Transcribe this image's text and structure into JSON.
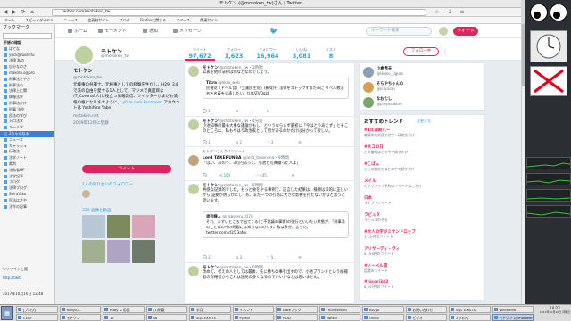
{
  "window": {
    "title": "モトケン (@motoken_tw)さん | Twitter"
  },
  "browser": {
    "url": "twitter.com/motoken_tw",
    "bookmarks": [
      "ホーム",
      "スピードダイヤル",
      "ニュース",
      "会員制サイト",
      "ブログ",
      "Firefoxに関する",
      "スペース",
      "関連サイト"
    ]
  },
  "sidebar": {
    "header": "ブックマーク",
    "folder_label": "手帳の確認",
    "items": [
      "はてな",
      "yuck@fukenfu",
      "法律 私の",
      "自分なのさ",
      "makoto.s@pro",
      "刑事法さやか",
      "刑事法の...",
      "法律上に関",
      "情報法学",
      "刑事法かけ",
      "刑事 法令",
      "民法の学び",
      "入口法学",
      "ルール学",
      "2ちゃんねる",
      "ニュース",
      "キャッシュ",
      "行政法",
      "法学ノート",
      "裁判",
      "法務省HP",
      "法学記事",
      "ブログ",
      "法律ブログ",
      "ShiraYako",
      "民法はさや",
      "法令の記事"
    ],
    "selected_index": 14,
    "footer_text": "ウクライナと聞",
    "footer_link": "http://twitt",
    "date": "2017年10月16日 12:48"
  },
  "twitter": {
    "nav": [
      "ホーム",
      "モーメント",
      "通知",
      "メッセージ"
    ],
    "search_placeholder": "キーワード検索",
    "tweet_button": "ツイート",
    "profile": {
      "name": "モトケン",
      "handle": "@motoken_tw",
      "stats": [
        {
          "label": "ツイート",
          "value": "97,672"
        },
        {
          "label": "フォロー",
          "value": "1,623"
        },
        {
          "label": "フォロワー",
          "value": "16,964"
        },
        {
          "label": "いいね",
          "value": "3,081"
        },
        {
          "label": "リスト",
          "value": "8"
        }
      ],
      "follow_button": "フォロー中",
      "bio_name": "モトケン",
      "bio_handle": "@motoken_tw",
      "bio_text": "元検事の弁護士。元検事としての経験を生かし、H29. 3まで法の自由を愛する1人として、マジメで真面目な(T_Corona?人)に役立つ情報発信、ツイッターがまだも情報の根になりますように。",
      "bio_link_text": "yfaio.com Facebook",
      "bio_more": "アカウントは Yoshihiro Yabe",
      "bio_site": "motoken.net",
      "bio_joined": "2009年12月に登録",
      "bio_tweet_btn": "ツイート",
      "followers_you_know": "1人の知り合いのフォロワー",
      "media_label": "329 画像と動画"
    }
  },
  "tweets": [
    {
      "name": "モトケン",
      "handle": "@motoken_tw",
      "time": "・3時間",
      "body": "公表を他の法律は何などなのでしょう。",
      "quote_author": "Tikra",
      "quote_handle": "@tikra_web",
      "quote_text": "民進党（ドベル音）「立憲民主党」(新党)行 法律をストップするために リベル教法名を名義を公表したい。tl.tt/ZVQqzL",
      "actions": [
        "1",
        "",
        "",
        ""
      ]
    },
    {
      "name": "モトケン",
      "handle": "@motoken_tw",
      "time": "・4分前",
      "body": "小池知事の最も大事な議論がもし、というならまず最初に「今はとりあえず」とそこのところに、私もやはり政治家として何があるのかだけは分かって欲しい。",
      "actions": [
        "1",
        "2",
        "3",
        ""
      ]
    },
    {
      "retweeted": "モトケンさんがリツイート",
      "name": "Lord TAKERUNBA",
      "handle": "@lord_takeruna",
      "time": "・9時間",
      "body": "「はい、あのう、3万円払って、小池と写真撮った人よ」",
      "actions": [
        "",
        "164",
        "445",
        ""
      ]
    },
    {
      "name": "モトケン",
      "handle": "@motoken_tw",
      "time": "・6時間",
      "body": "共感な記録的でした。もっと食をやる事例で、証言した結果は、検察は法的に正しいから 証拠が明らかにしても、まだ一つの行為に大きな影響を持たないかなと思うと思います。",
      "quote_author": "渡辺輝人",
      "quote_handle": "@nabeteru1Q78",
      "quote_text": "それ、まずいところで出てくる(と不思議の事情)の強行といいたい状態が、「刑事法のことばの中の問題には知らないのです。私は多分、言った。　twitter.com/d1f23aNv.",
      "actions": [
        "2",
        "3",
        "5",
        ""
      ]
    },
    {
      "name": "モトケン",
      "handle": "@motoken_tw",
      "time": "・6時間",
      "body": "改めて、考えの人としては最後、先に勝ちの事を出すので、小池プランドという候補者の有権者からこれは国民の多くなるのでいいかなとは思いません。",
      "actions": [
        "",
        "",
        "",
        ""
      ]
    }
  ],
  "right": {
    "suggestions": [
      {
        "name": "小倉秀夫",
        "handle": "@Hideo_Ogura"
      },
      {
        "name": "そらやちゃんの",
        "handle": "@kriyasan"
      },
      {
        "name": "なおむし",
        "handle": "@proyasabine"
      }
    ],
    "trends_title": "おすすめトレンド",
    "trends_change": "変更する",
    "trends": [
      {
        "tag": "#1年満期バー",
        "sub": "感情的な知見の文字・研究方法は..."
      },
      {
        "tag": "#ネコの日",
        "sub": "この番組はこの中で試すだけ"
      },
      {
        "tag": "#こばん",
        "sub": "こらの話あてはこの中で試すだけ"
      },
      {
        "tag": "メイル",
        "sub": "ピックアップ予約のツイートはこちら"
      },
      {
        "tag": "日本",
        "sub": "ライブ・ツイート"
      },
      {
        "tag": "ラビュタ",
        "sub": "ラビュタの予告"
      },
      {
        "tag": "#大人の学びミサンドロップ",
        "sub": "3,1万件のツイート"
      },
      {
        "tag": "アリサーディ・ヴィ",
        "sub": "6,156件のツイート"
      },
      {
        "tag": "#ノーベル賞",
        "sub": "話題のツイート"
      },
      {
        "tag": "#nicori342",
        "sub": "6,245件のツイート"
      }
    ]
  },
  "taskbar": {
    "tasks": [
      "[ブログ]",
      "Rubyの...",
      "Ruby & 用語",
      "(1)例題",
      "半月",
      "イベント",
      "Noteブック",
      "Thunderbird",
      "Bのyo",
      "お問い合わせ",
      "SQL EXISTS",
      "Wikipedia",
      "CLAF",
      "モトケン",
      "1k",
      "oo",
      "SQL EXISTS",
      "PyMol",
      "HDD",
      "Twitter",
      "Unico",
      "ビデオ",
      "2ちゃん",
      "モトケン (@motoken_tw)"
    ],
    "active_index": 23,
    "clock_time": "10:22",
    "clock_date": "2017年10月16日 月曜日"
  },
  "colors": {
    "twitter_blue": "#1da1f2",
    "tweet_button": "#e0245e",
    "page_bg": "#e6ecf0"
  }
}
